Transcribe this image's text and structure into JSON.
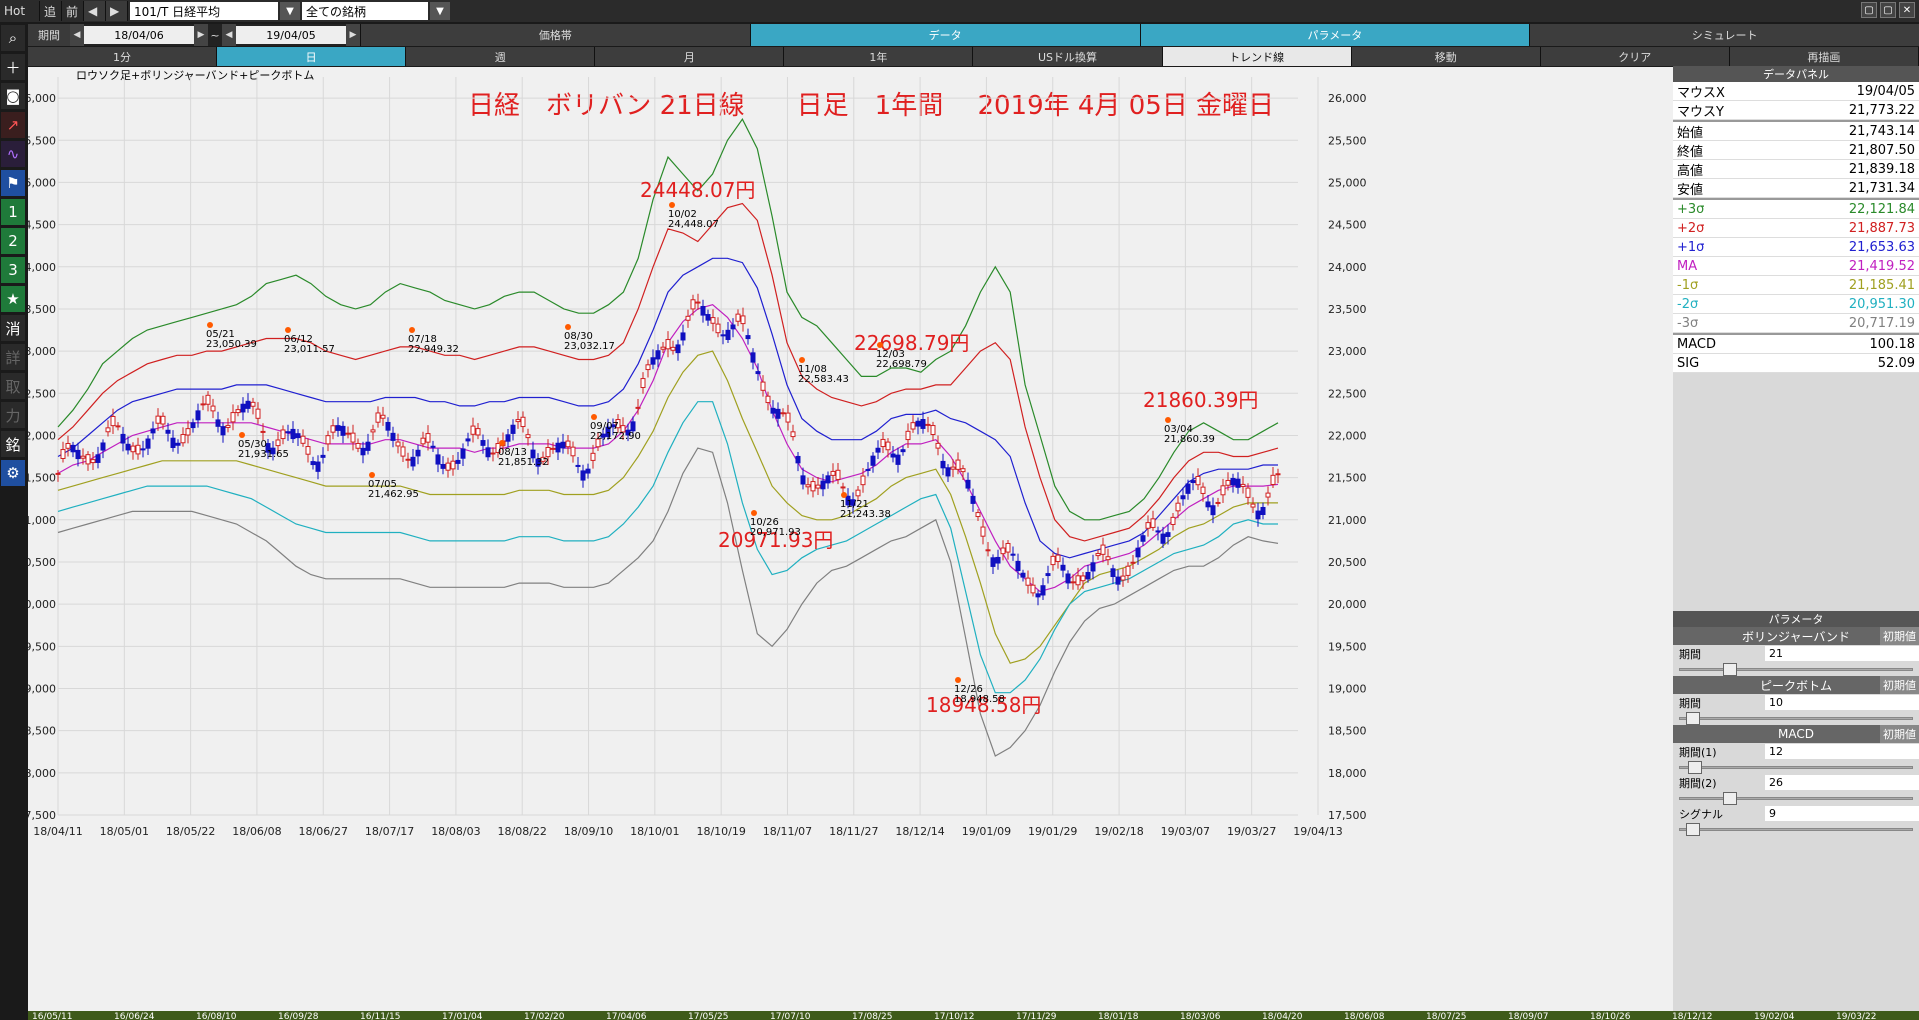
{
  "topbar": {
    "hot": "Hot",
    "oi": "追",
    "mae": "前",
    "symbol": "101/T 日経平均",
    "universe": "全ての銘柄"
  },
  "period_bar": {
    "label": "期間",
    "from": "18/04/06",
    "tilde": "~",
    "to": "19/04/05",
    "tabs": [
      "価格帯",
      "データ",
      "パラメータ",
      "シミュレート"
    ]
  },
  "range_bar": {
    "tabs": [
      "1分",
      "日",
      "週",
      "月",
      "1年",
      "USドル換算",
      "トレンド線",
      "移動",
      "クリア",
      "再描画"
    ]
  },
  "left_tools": [
    "zoom-icon",
    "plus-icon",
    "camera-icon",
    "line-chart-icon",
    "indicator-icon",
    "flag-icon",
    "1",
    "2",
    "3",
    "star-icon",
    "消",
    "詳",
    "取",
    "力",
    "銘",
    "gear-icon"
  ],
  "chart": {
    "subtitle": "ロウソク足+ボリンジャーバンド+ピークボトム",
    "title": "日経　ボリバン 21日線　　日足　1年間　 2019年 4月 05日 金曜日",
    "annotations": [
      {
        "text": "24448.07円"
      },
      {
        "text": "22698.79円"
      },
      {
        "text": "21860.39円"
      },
      {
        "text": "20971.93円"
      },
      {
        "text": "18948.58円"
      }
    ],
    "peak_labels": [
      {
        "d": "05/21",
        "v": "23,050.39"
      },
      {
        "d": "06/12",
        "v": "23,011.57"
      },
      {
        "d": "07/18",
        "v": "22,949.32"
      },
      {
        "d": "08/30",
        "v": "23,032.17"
      },
      {
        "d": "10/02",
        "v": "24,448.07"
      },
      {
        "d": "11/08",
        "v": "22,583.43"
      },
      {
        "d": "12/03",
        "v": "22,698.79"
      },
      {
        "d": "03/04",
        "v": "21,860.39"
      },
      {
        "d": "05/30",
        "v": "21,931.65"
      },
      {
        "d": "07/05",
        "v": "21,462.95"
      },
      {
        "d": "08/13",
        "v": "21,851.32"
      },
      {
        "d": "09/07",
        "v": "22,172.90"
      },
      {
        "d": "10/26",
        "v": "20,971.93"
      },
      {
        "d": "11/21",
        "v": "21,243.38"
      },
      {
        "d": "12/26",
        "v": "18,948.58"
      }
    ]
  },
  "chart_data": {
    "type": "line",
    "ylim": [
      17500,
      26250
    ],
    "yticks": [
      "26,000",
      "25,500",
      "25,000",
      "24,500",
      "24,000",
      "23,500",
      "23,000",
      "22,500",
      "22,000",
      "21,500",
      "21,000",
      "20,500",
      "20,000",
      "19,500",
      "19,000",
      "18,500",
      "18,000",
      "17,500"
    ],
    "x_ticks": [
      "18/04/11",
      "18/05/01",
      "18/05/22",
      "18/06/08",
      "18/06/27",
      "18/07/17",
      "18/08/03",
      "18/08/22",
      "18/09/10",
      "18/10/01",
      "18/10/19",
      "18/11/07",
      "18/11/27",
      "18/12/14",
      "19/01/09",
      "19/01/29",
      "19/02/18",
      "19/03/07",
      "19/03/27",
      "19/04/13"
    ],
    "bottom_ticks": [
      "16/05/11",
      "16/06/24",
      "16/08/10",
      "16/09/28",
      "16/11/15",
      "17/01/04",
      "17/02/20",
      "17/04/06",
      "17/05/25",
      "17/07/10",
      "17/08/25",
      "17/10/12",
      "17/11/29",
      "18/01/18",
      "18/03/06",
      "18/04/20",
      "18/06/08",
      "18/07/25",
      "18/09/07",
      "18/10/26",
      "18/12/12",
      "19/02/04",
      "19/03/22"
    ],
    "series": [
      {
        "name": "+3σ",
        "color": "#2a8a2a",
        "values": [
          22100,
          22300,
          22550,
          22850,
          23000,
          23150,
          23250,
          23300,
          23350,
          23400,
          23450,
          23500,
          23550,
          23650,
          23800,
          23850,
          23900,
          23800,
          23650,
          23550,
          23500,
          23550,
          23700,
          23800,
          23750,
          23700,
          23600,
          23550,
          23500,
          23550,
          23650,
          23700,
          23700,
          23600,
          23500,
          23450,
          23450,
          23550,
          23700,
          24100,
          24800,
          25300,
          25100,
          24900,
          25100,
          25500,
          25750,
          25400,
          24600,
          23700,
          23400,
          23300,
          23100,
          22900,
          22700,
          22700,
          22800,
          22800,
          22750,
          22900,
          23000,
          23300,
          23700,
          24000,
          23700,
          22600,
          22000,
          21400,
          21100,
          21000,
          21000,
          21050,
          21100,
          21250,
          21500,
          21800,
          22050,
          22150,
          22050,
          21950,
          21950,
          22050,
          22150
        ]
      },
      {
        "name": "+2σ",
        "color": "#d02020",
        "values": [
          21950,
          22100,
          22300,
          22500,
          22650,
          22750,
          22850,
          22900,
          22950,
          22950,
          23000,
          23000,
          23050,
          23100,
          23150,
          23150,
          23150,
          23100,
          23000,
          22950,
          22900,
          22950,
          23000,
          23050,
          23050,
          23000,
          22950,
          22950,
          22900,
          22950,
          23000,
          23050,
          23050,
          23000,
          22950,
          22900,
          22900,
          22950,
          23100,
          23500,
          24000,
          24450,
          24400,
          24300,
          24500,
          24700,
          24750,
          24550,
          23900,
          23100,
          22700,
          22550,
          22450,
          22400,
          22350,
          22400,
          22500,
          22550,
          22550,
          22600,
          22600,
          22800,
          23000,
          23100,
          22900,
          22100,
          21500,
          21000,
          20800,
          20750,
          20800,
          20850,
          20900,
          21050,
          21250,
          21500,
          21700,
          21800,
          21800,
          21750,
          21750,
          21800,
          21850
        ]
      },
      {
        "name": "+1σ",
        "color": "#2020d0",
        "values": [
          21750,
          21850,
          22000,
          22150,
          22300,
          22400,
          22450,
          22500,
          22550,
          22550,
          22550,
          22550,
          22600,
          22600,
          22600,
          22550,
          22500,
          22450,
          22400,
          22400,
          22400,
          22400,
          22450,
          22450,
          22450,
          22400,
          22400,
          22350,
          22350,
          22400,
          22400,
          22450,
          22450,
          22450,
          22400,
          22350,
          22350,
          22400,
          22550,
          22850,
          23250,
          23700,
          23900,
          24000,
          24100,
          24100,
          24050,
          23750,
          23200,
          22600,
          22200,
          22050,
          21950,
          21950,
          21950,
          22050,
          22200,
          22250,
          22250,
          22300,
          22200,
          22150,
          22050,
          21950,
          21750,
          21200,
          20750,
          20600,
          20550,
          20600,
          20650,
          20700,
          20750,
          20850,
          21050,
          21250,
          21450,
          21550,
          21600,
          21600,
          21600,
          21650,
          21650
        ]
      },
      {
        "name": "MA",
        "color": "#c020c0",
        "values": [
          21550,
          21650,
          21700,
          21800,
          21900,
          22000,
          22050,
          22100,
          22150,
          22150,
          22150,
          22150,
          22150,
          22150,
          22100,
          22050,
          22000,
          21950,
          21900,
          21900,
          21900,
          21900,
          21950,
          21950,
          21900,
          21850,
          21850,
          21850,
          21800,
          21850,
          21850,
          21900,
          21900,
          21900,
          21850,
          21850,
          21850,
          21900,
          22050,
          22300,
          22650,
          23100,
          23350,
          23500,
          23550,
          23400,
          23150,
          22800,
          22300,
          21900,
          21600,
          21500,
          21450,
          21500,
          21550,
          21650,
          21800,
          21900,
          21900,
          21950,
          21750,
          21450,
          21100,
          20750,
          20450,
          20300,
          20150,
          20200,
          20300,
          20450,
          20500,
          20550,
          20600,
          20700,
          20850,
          21000,
          21150,
          21250,
          21350,
          21400,
          21400,
          21400,
          21420
        ]
      },
      {
        "name": "-1σ",
        "color": "#a0a020",
        "values": [
          21350,
          21400,
          21450,
          21500,
          21550,
          21600,
          21650,
          21700,
          21700,
          21700,
          21700,
          21700,
          21700,
          21650,
          21600,
          21550,
          21500,
          21450,
          21400,
          21400,
          21400,
          21400,
          21400,
          21400,
          21350,
          21300,
          21300,
          21300,
          21300,
          21300,
          21300,
          21350,
          21350,
          21350,
          21300,
          21300,
          21300,
          21350,
          21500,
          21750,
          22050,
          22450,
          22750,
          22950,
          23000,
          22650,
          22200,
          21800,
          21400,
          21200,
          21050,
          21000,
          21000,
          21050,
          21150,
          21250,
          21400,
          21500,
          21550,
          21600,
          21300,
          20800,
          20250,
          19650,
          19300,
          19350,
          19500,
          19750,
          20000,
          20250,
          20350,
          20400,
          20450,
          20550,
          20650,
          20800,
          20900,
          20950,
          21050,
          21150,
          21200,
          21200,
          21200
        ]
      },
      {
        "name": "-2σ",
        "color": "#20b0c0",
        "values": [
          21100,
          21150,
          21200,
          21250,
          21300,
          21350,
          21400,
          21400,
          21400,
          21400,
          21400,
          21350,
          21300,
          21250,
          21150,
          21050,
          20950,
          20900,
          20850,
          20850,
          20850,
          20850,
          20850,
          20850,
          20800,
          20750,
          20750,
          20750,
          20750,
          20750,
          20750,
          20800,
          20800,
          20800,
          20750,
          20750,
          20750,
          20800,
          20950,
          21150,
          21400,
          21800,
          22150,
          22400,
          22400,
          21900,
          21200,
          20650,
          20350,
          20400,
          20550,
          20650,
          20700,
          20750,
          20850,
          20950,
          21050,
          21150,
          21250,
          21300,
          20900,
          20150,
          19400,
          18950,
          18950,
          19100,
          19350,
          19700,
          20000,
          20150,
          20200,
          20250,
          20300,
          20400,
          20500,
          20600,
          20650,
          20700,
          20800,
          20950,
          21000,
          20950,
          20950
        ]
      },
      {
        "name": "-3σ",
        "color": "#808080",
        "values": [
          20850,
          20900,
          20950,
          21000,
          21050,
          21100,
          21100,
          21100,
          21100,
          21100,
          21050,
          21000,
          20950,
          20850,
          20750,
          20600,
          20450,
          20350,
          20300,
          20300,
          20300,
          20300,
          20300,
          20300,
          20250,
          20200,
          20200,
          20200,
          20200,
          20200,
          20200,
          20250,
          20250,
          20250,
          20200,
          20200,
          20200,
          20250,
          20400,
          20550,
          20750,
          21100,
          21550,
          21850,
          21800,
          21200,
          20400,
          19650,
          19500,
          19700,
          20000,
          20250,
          20400,
          20450,
          20550,
          20650,
          20750,
          20800,
          20900,
          21000,
          20500,
          19600,
          18700,
          18200,
          18300,
          18500,
          18800,
          19200,
          19550,
          19800,
          19950,
          20000,
          20100,
          20200,
          20300,
          20400,
          20450,
          20450,
          20550,
          20700,
          20800,
          20750,
          20720
        ]
      }
    ],
    "candles_summary": "daily candlesticks Nikkei 225, Apr 2018 - Apr 2019"
  },
  "data_panel": {
    "title": "データパネル",
    "rows": [
      {
        "k": "マウスX",
        "v": "19/04/05",
        "color": "#000"
      },
      {
        "k": "マウスY",
        "v": "21,773.22",
        "color": "#000"
      },
      {
        "k": "始値",
        "v": "21,743.14",
        "color": "#000"
      },
      {
        "k": "終値",
        "v": "21,807.50",
        "color": "#000"
      },
      {
        "k": "高値",
        "v": "21,839.18",
        "color": "#000"
      },
      {
        "k": "安値",
        "v": "21,731.34",
        "color": "#000"
      },
      {
        "k": "+3σ",
        "v": "22,121.84",
        "color": "#2a8a2a"
      },
      {
        "k": "+2σ",
        "v": "21,887.73",
        "color": "#d02020"
      },
      {
        "k": "+1σ",
        "v": "21,653.63",
        "color": "#2020d0"
      },
      {
        "k": "MA",
        "v": "21,419.52",
        "color": "#c020c0"
      },
      {
        "k": "-1σ",
        "v": "21,185.41",
        "color": "#a0a020"
      },
      {
        "k": "-2σ",
        "v": "20,951.30",
        "color": "#20b0c0"
      },
      {
        "k": "-3σ",
        "v": "20,717.19",
        "color": "#808080"
      },
      {
        "k": "MACD",
        "v": "100.18",
        "color": "#000"
      },
      {
        "k": "SIG",
        "v": "52.09",
        "color": "#000"
      }
    ]
  },
  "params": {
    "title": "パラメータ",
    "init_label": "初期値",
    "groups": [
      {
        "name": "ボリンジャーバンド",
        "rows": [
          {
            "k": "期間",
            "v": "21",
            "pos": 0.2
          }
        ]
      },
      {
        "name": "ピークボトム",
        "rows": [
          {
            "k": "期間",
            "v": "10",
            "pos": 0.03
          }
        ]
      },
      {
        "name": "MACD",
        "rows": [
          {
            "k": "期間(1)",
            "v": "12",
            "pos": 0.04
          },
          {
            "k": "期間(2)",
            "v": "26",
            "pos": 0.2
          },
          {
            "k": "シグナル",
            "v": "9",
            "pos": 0.03
          }
        ]
      }
    ]
  }
}
